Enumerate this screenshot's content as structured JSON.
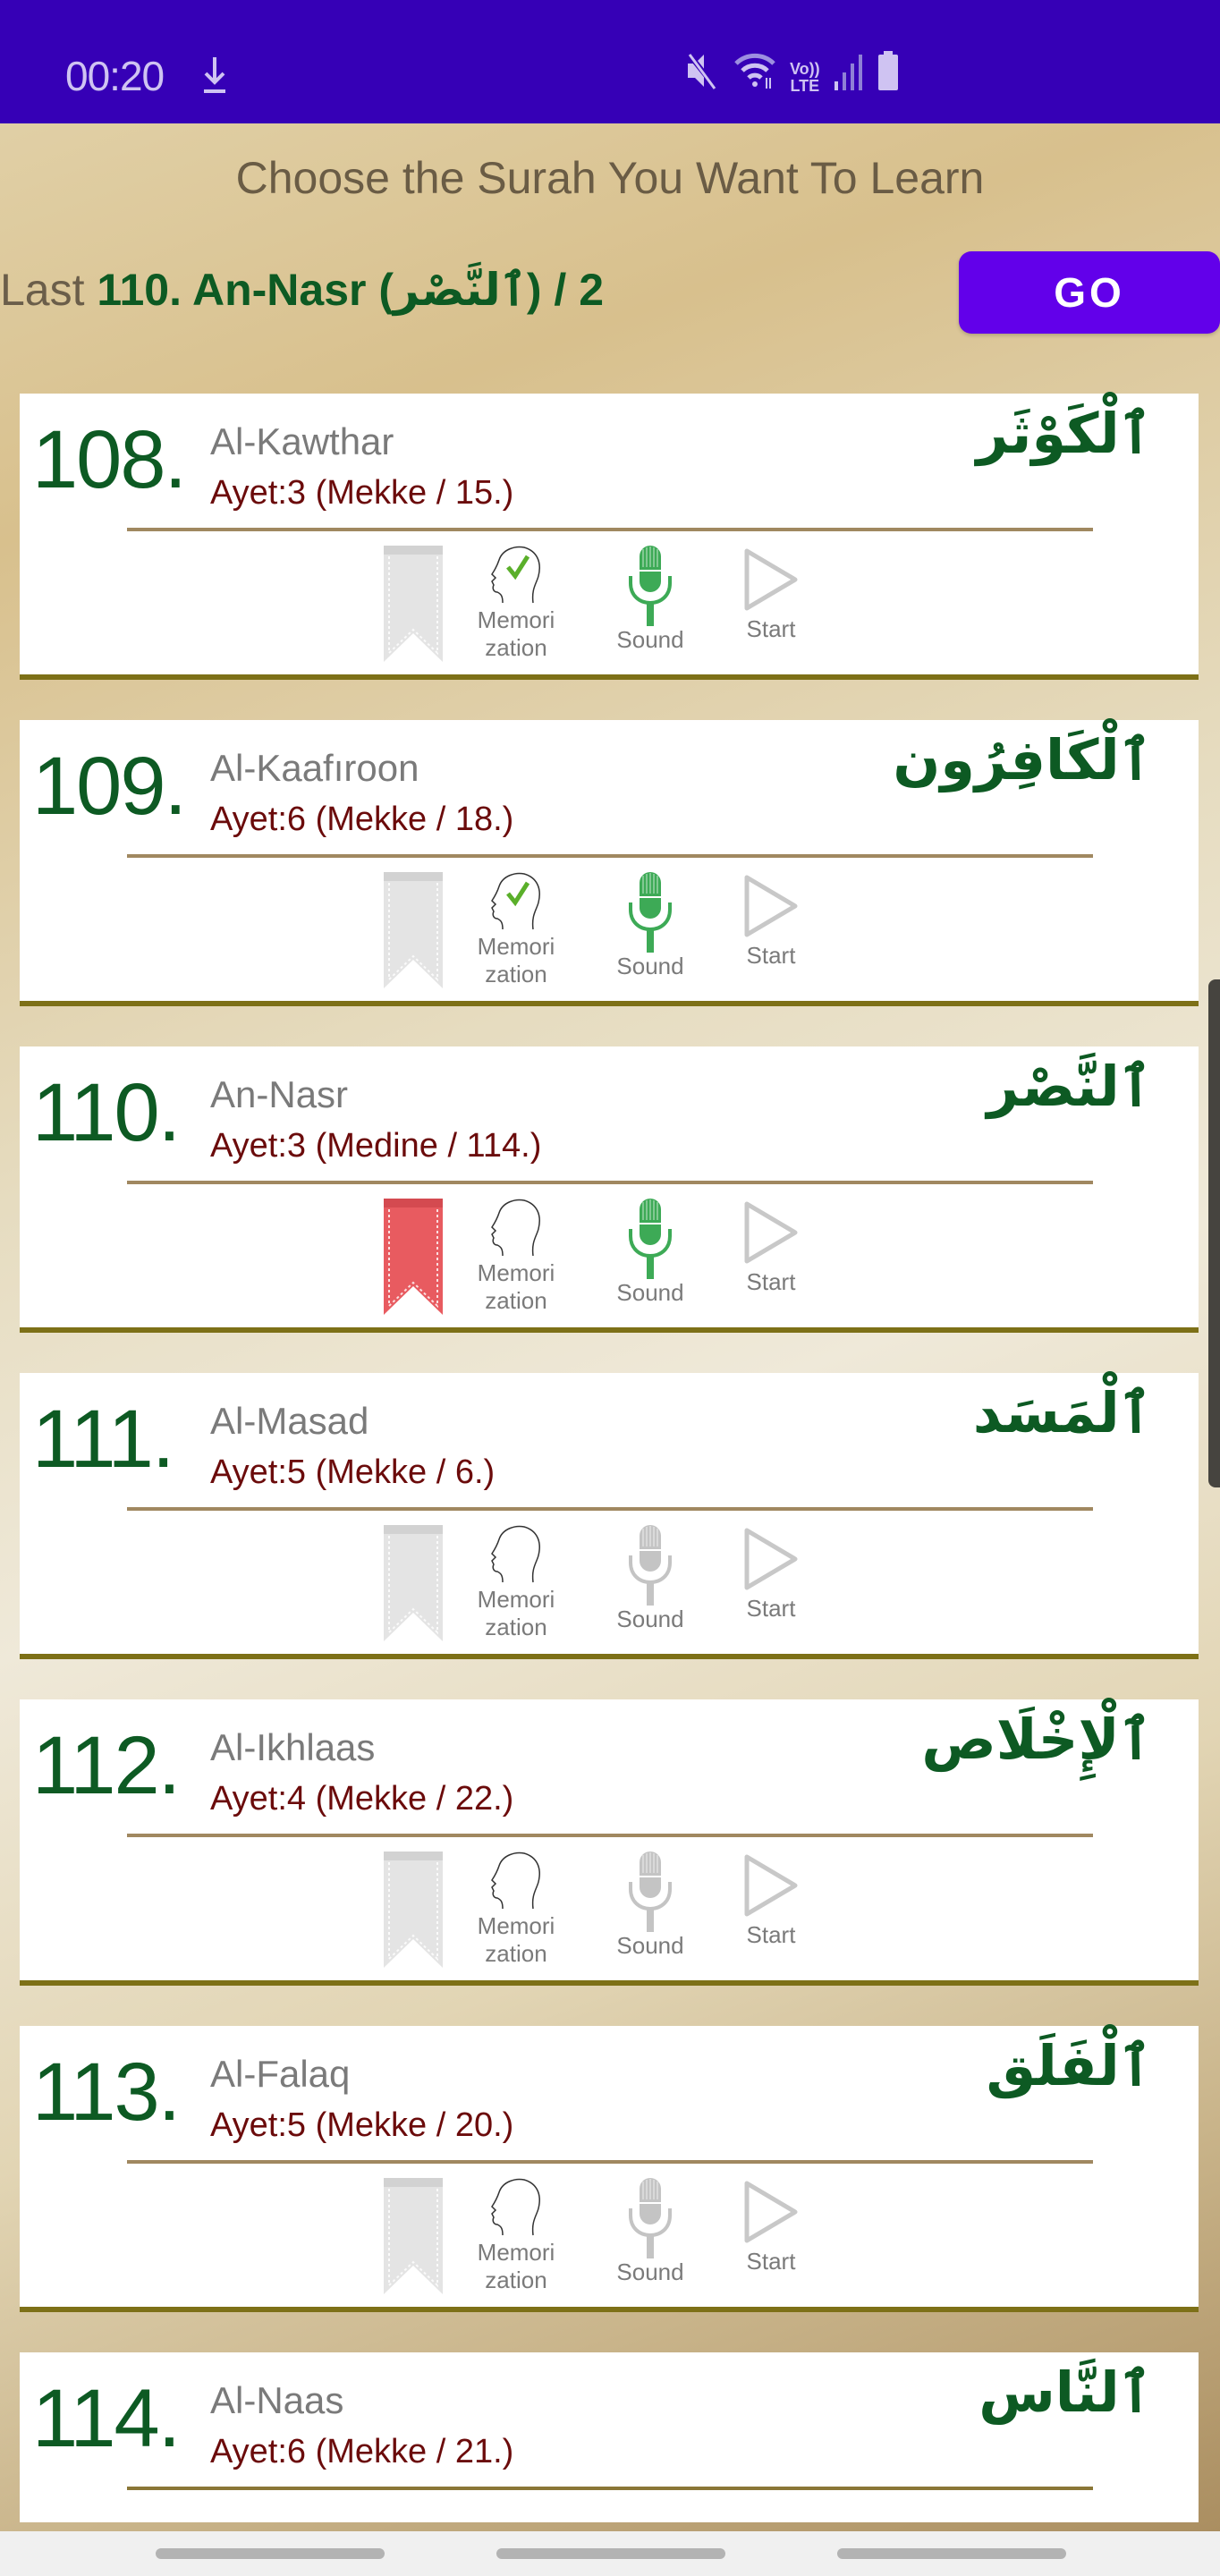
{
  "status_bar": {
    "time": "00:20",
    "icons": [
      "download-icon",
      "mute-icon",
      "wifi-icon",
      "volte-lte-icon",
      "signal-icon",
      "battery-icon"
    ],
    "lte_top": "Vo))",
    "lte_bottom": "LTE",
    "background": "#3600b6"
  },
  "header": {
    "title": "Choose the Surah You Want To Learn",
    "last_label": "Last ",
    "last_value": "110. An-Nasr (ٱلنَّصْر) / 2",
    "go_button": "GO",
    "accent": "#6200ea"
  },
  "colors": {
    "number": "#0d5a23",
    "name": "#7a7a7a",
    "ayet": "#6b0b0b",
    "card_border": "#7d7017",
    "divider": "#a08860",
    "active_green": "#3daa56",
    "bookmark_active": "#e85b60",
    "inactive_grey": "#c4c4c4"
  },
  "surahs": [
    {
      "number": "108.",
      "name": "Al-Kawthar",
      "ayet": "Ayet:3 (Mekke / 15.)",
      "arabic": "ٱلْكَوْثَر",
      "bookmarked": false,
      "memorized": true,
      "sound": true
    },
    {
      "number": "109.",
      "name": "Al-Kaafıroon",
      "ayet": "Ayet:6 (Mekke / 18.)",
      "arabic": "ٱلْكَافِرُون",
      "bookmarked": false,
      "memorized": true,
      "sound": true
    },
    {
      "number": "110.",
      "name": "An-Nasr",
      "ayet": "Ayet:3 (Medine / 114.)",
      "arabic": "ٱلنَّصْر",
      "bookmarked": true,
      "memorized": false,
      "sound": true
    },
    {
      "number": "111.",
      "name": "Al-Masad",
      "ayet": "Ayet:5 (Mekke / 6.)",
      "arabic": "ٱلْمَسَد",
      "bookmarked": false,
      "memorized": false,
      "sound": false
    },
    {
      "number": "112.",
      "name": "Al-Ikhlaas",
      "ayet": "Ayet:4 (Mekke / 22.)",
      "arabic": "ٱلْإِخْلَاص",
      "bookmarked": false,
      "memorized": false,
      "sound": false
    },
    {
      "number": "113.",
      "name": "Al-Falaq",
      "ayet": "Ayet:5 (Mekke / 20.)",
      "arabic": "ٱلْفَلَق",
      "bookmarked": false,
      "memorized": false,
      "sound": false
    },
    {
      "number": "114.",
      "name": "Al-Naas",
      "ayet": "Ayet:6 (Mekke / 21.)",
      "arabic": "ٱلنَّاس",
      "bookmarked": false,
      "memorized": false,
      "sound": false
    }
  ],
  "actions": {
    "memorization_line1": "Memori",
    "memorization_line2": "zation",
    "sound": "Sound",
    "start": "Start"
  }
}
